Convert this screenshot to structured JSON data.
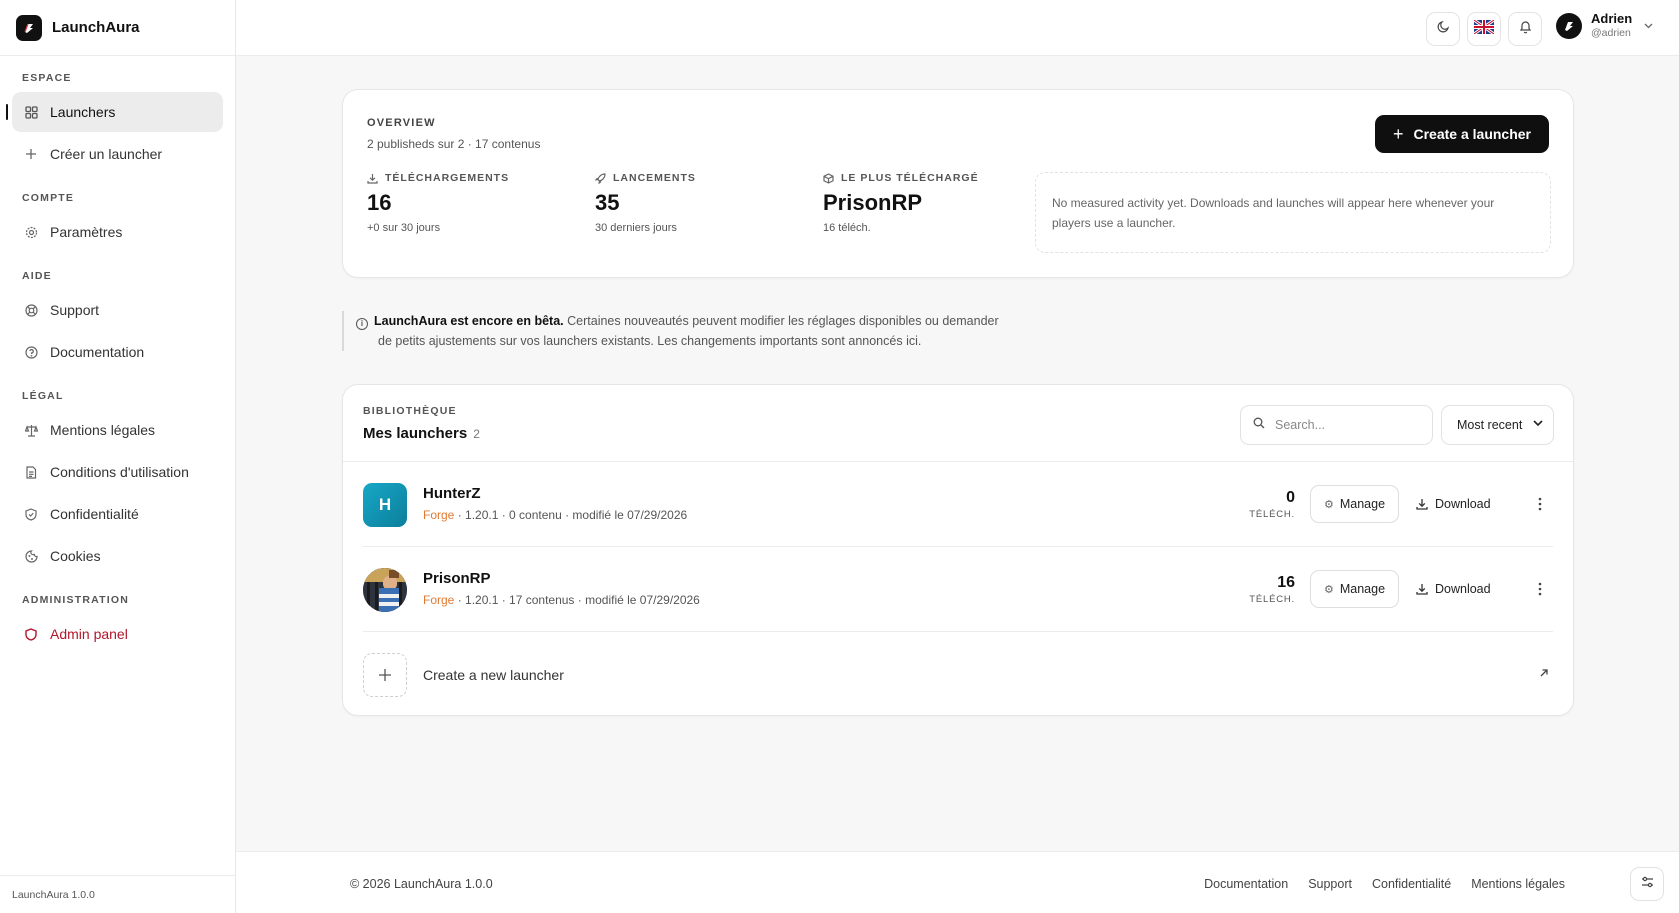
{
  "app": {
    "name": "LaunchAura",
    "version_label": "LaunchAura 1.0.0"
  },
  "sidebar": {
    "sections": [
      {
        "title": "ESPACE",
        "items": [
          {
            "label": "Launchers",
            "icon": "grid-icon",
            "active": true
          },
          {
            "label": "Créer un launcher",
            "icon": "plus-icon"
          }
        ]
      },
      {
        "title": "COMPTE",
        "items": [
          {
            "label": "Paramètres",
            "icon": "gear-icon"
          }
        ]
      },
      {
        "title": "AIDE",
        "items": [
          {
            "label": "Support",
            "icon": "lifebuoy-icon"
          },
          {
            "label": "Documentation",
            "icon": "help-circle-icon"
          }
        ]
      },
      {
        "title": "LÉGAL",
        "items": [
          {
            "label": "Mentions légales",
            "icon": "scale-icon"
          },
          {
            "label": "Conditions d'utilisation",
            "icon": "document-icon"
          },
          {
            "label": "Confidentialité",
            "icon": "shield-check-icon"
          },
          {
            "label": "Cookies",
            "icon": "cookie-icon"
          }
        ]
      },
      {
        "title": "ADMINISTRATION",
        "items": [
          {
            "label": "Admin panel",
            "icon": "shield-icon",
            "color": "#b0172b"
          }
        ]
      }
    ]
  },
  "topbar": {
    "theme_icon": "moon-icon",
    "language_icon": "uk-flag-icon",
    "notifications_icon": "bell-icon",
    "user": {
      "name": "Adrien",
      "handle": "@adrien"
    }
  },
  "overview": {
    "label": "OVERVIEW",
    "subtitle": "2 publisheds sur 2 · 17 contenus",
    "create_button": "Create a launcher",
    "stats": [
      {
        "label": "TÉLÉCHARGEMENTS",
        "value": "16",
        "foot": "+0 sur 30 jours",
        "icon": "download-icon"
      },
      {
        "label": "LANCEMENTS",
        "value": "35",
        "foot": "30 derniers jours",
        "icon": "rocket-icon"
      },
      {
        "label": "LE PLUS TÉLÉCHARGÉ",
        "value": "PrisonRP",
        "foot": "16 téléch.",
        "icon": "box-icon"
      }
    ],
    "activity_note": "No measured activity yet. Downloads and launches will appear here whenever your players use a launcher."
  },
  "notice": {
    "bold": "LaunchAura est encore en bêta.",
    "text_line1": "Certaines nouveautés peuvent modifier les réglages disponibles ou demander",
    "text_line2": "de petits ajustements sur vos launchers existants. Les changements importants sont annoncés ici."
  },
  "library": {
    "label": "BIBLIOTHÈQUE",
    "title": "Mes launchers",
    "count": "2",
    "search_placeholder": "Search...",
    "sort_value": "Most recent",
    "rows": [
      {
        "name": "HunterZ",
        "initial": "H",
        "loader": "Forge",
        "meta": " · 1.20.1 · 0 contenu · modifié le 07/29/2026",
        "downloads": "0",
        "downloads_label": "TÉLÉCH.",
        "manage": "Manage",
        "download": "Download"
      },
      {
        "name": "PrisonRP",
        "loader": "Forge",
        "meta": " · 1.20.1 · 17 contenus · modifié le 07/29/2026",
        "downloads": "16",
        "downloads_label": "TÉLÉCH.",
        "manage": "Manage",
        "download": "Download"
      }
    ],
    "new_launcher": "Create a new launcher"
  },
  "footer": {
    "copyright": "© 2026 LaunchAura 1.0.0",
    "links": [
      "Documentation",
      "Support",
      "Confidentialité",
      "Mentions légales"
    ]
  },
  "colors": {
    "accent": "#0f0f0f",
    "loader": "#e07a32",
    "admin": "#b0172b"
  }
}
